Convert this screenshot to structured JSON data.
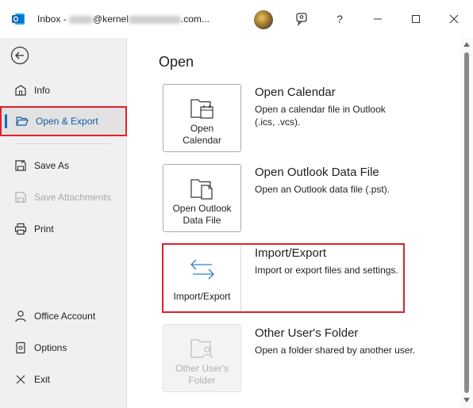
{
  "window": {
    "title_prefix": "Inbox - ",
    "title_blur1": "jolly",
    "title_domain": "@kernel",
    "title_blur2": "datarecovery",
    "title_suffix": ".com...",
    "help_label": "?"
  },
  "sidebar": {
    "items": [
      {
        "label": "Info",
        "icon": "info-icon"
      },
      {
        "label": "Open & Export",
        "icon": "folder-open-icon",
        "selected": true
      },
      {
        "label": "Save As",
        "icon": "save-as-icon"
      },
      {
        "label": "Save Attachments",
        "icon": "attachment-icon",
        "disabled": true
      },
      {
        "label": "Print",
        "icon": "print-icon"
      },
      {
        "label": "Office Account",
        "icon": "person-icon"
      },
      {
        "label": "Options",
        "icon": "options-icon"
      },
      {
        "label": "Exit",
        "icon": "close-icon"
      }
    ]
  },
  "main": {
    "heading": "Open",
    "options": [
      {
        "tile_label_1": "Open",
        "tile_label_2": "Calendar",
        "title": "Open Calendar",
        "desc_1": "Open a calendar file in Outlook",
        "desc_2": "(.ics, .vcs)."
      },
      {
        "tile_label_1": "Open Outlook",
        "tile_label_2": "Data File",
        "title": "Open Outlook Data File",
        "desc_1": "Open an Outlook data file (.pst)."
      },
      {
        "tile_label_1": "Import/Export",
        "title": "Import/Export",
        "desc_1": "Import or export files and settings."
      },
      {
        "tile_label_1": "Other User's",
        "tile_label_2": "Folder",
        "title": "Other User's Folder",
        "desc_1": "Open a folder shared by another user.",
        "disabled": true
      }
    ]
  },
  "colors": {
    "accent": "#0f6cbd",
    "highlight": "#e0202a",
    "sidebar_bg": "#f0f0f0"
  }
}
